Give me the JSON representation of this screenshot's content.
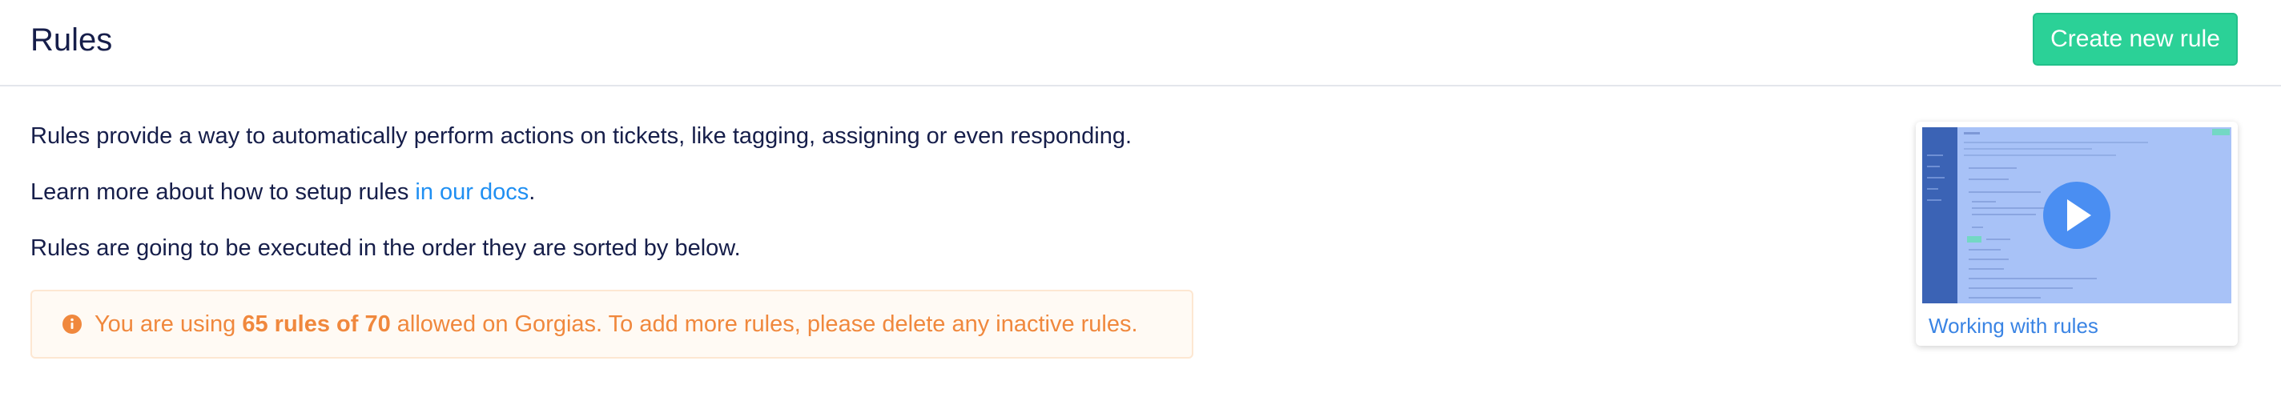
{
  "header": {
    "title": "Rules",
    "create_button_label": "Create new rule"
  },
  "intro": {
    "line1": "Rules provide a way to automatically perform actions on tickets, like tagging, assigning or even responding.",
    "line2_before": "Learn more about how to setup rules ",
    "line2_link": "in our docs",
    "line2_after": ".",
    "line3": "Rules are going to be executed in the order they are sorted by below."
  },
  "alert": {
    "prefix": "You are using ",
    "count": "65 rules of 70",
    "suffix": " allowed on Gorgias. To add more rules, please delete any inactive rules.",
    "icon": "info-icon",
    "color": "#f0883d"
  },
  "video": {
    "caption": "Working with rules",
    "icon": "play-icon"
  },
  "colors": {
    "primary_button": "#2bd197",
    "link": "#1f8ff2",
    "heading": "#161e4a",
    "warning": "#f0883d"
  }
}
